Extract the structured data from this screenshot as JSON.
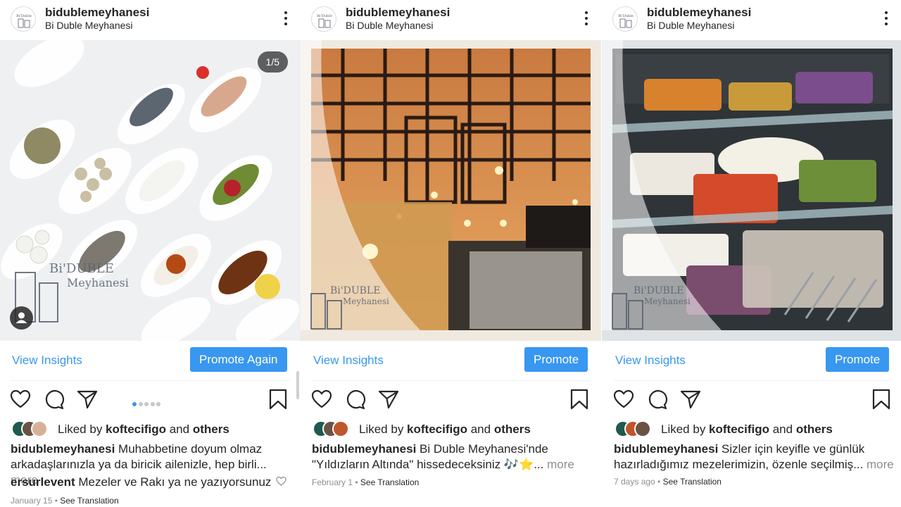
{
  "colors": {
    "accent": "#3897f0",
    "text": "#262626",
    "muted": "#8e8e8e"
  },
  "posts": [
    {
      "username": "bidublemeyhanesi",
      "location": "Bi Duble Meyhanesi",
      "carousel_counter": "1/5",
      "carousel_dots": 5,
      "carousel_active": 0,
      "photo_subject": "meze plates on a white table",
      "insights_label": "View Insights",
      "promote_label": "Promote Again",
      "liked_prefix": "Liked by ",
      "liked_user": "koftecifigo",
      "liked_and": " and ",
      "liked_others": "others",
      "caption_user": "bidublemeyhanesi",
      "caption_text": " Muhabbetine doyum olmaz arkadaşlarınızla ya da biricik ailenizle, hep birli...",
      "more_label": " more",
      "comment_user": "ersurlevent",
      "comment_text": " Mezeler ve Rakı ya ne yazıyorsunuz",
      "date": "January 15",
      "see_translation": "See Translation"
    },
    {
      "username": "bidublemeyhanesi",
      "location": "Bi Duble Meyhanesi",
      "photo_subject": "restaurant interior with hanging lamps",
      "insights_label": "View Insights",
      "promote_label": "Promote",
      "liked_prefix": "Liked by ",
      "liked_user": "koftecifigo",
      "liked_and": " and ",
      "liked_others": "others",
      "caption_user": "bidublemeyhanesi",
      "caption_text": " Bi Duble Meyhanesi'nde \"Yıldızların Altında\" hissedeceksiniz 🎶⭐...",
      "more_label": " more",
      "date": "February 1",
      "see_translation": "See Translation"
    },
    {
      "username": "bidublemeyhanesi",
      "location": "Bi Duble Meyhanesi",
      "photo_subject": "meze display fridge",
      "insights_label": "View Insights",
      "promote_label": "Promote",
      "liked_prefix": "Liked by ",
      "liked_user": "koftecifigo",
      "liked_and": " and ",
      "liked_others": "others",
      "caption_user": "bidublemeyhanesi",
      "caption_text": " Sizler için keyifle ve günlük hazırladığımız mezelerimizin, özenle seçilmiş...",
      "more_label": " more",
      "date": "7 days ago",
      "see_translation": "See Translation"
    }
  ],
  "meta_separator": " • "
}
